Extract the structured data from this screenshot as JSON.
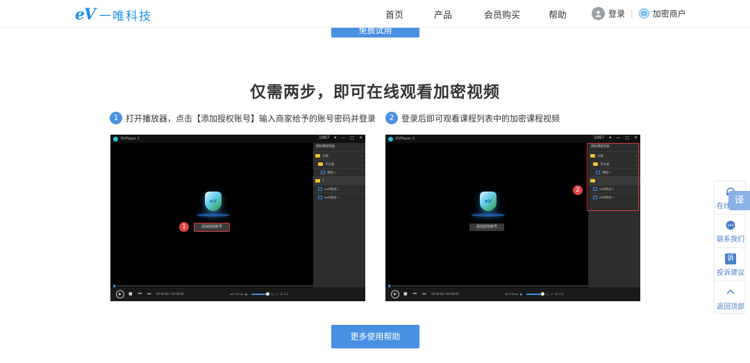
{
  "header": {
    "logo_mark": "eV",
    "logo_text": "一唯科技",
    "nav": [
      "首页",
      "产品",
      "会员购买",
      "帮助"
    ],
    "login": "登录",
    "separator": "|",
    "merchant": "加密商户"
  },
  "top_button": "免费试用",
  "section": {
    "title": "仅需两步，即可在线观看加密视频",
    "steps": [
      {
        "num": "1",
        "text": "打开播放器，点击【添加授权账号】输入商家给予的账号密码并登录"
      },
      {
        "num": "2",
        "text": "登录后即可观看课程列表中的加密课程视频"
      }
    ]
  },
  "players": [
    {
      "title": "EVPlayer 2",
      "user": "1997",
      "add_button": "添加授权账号",
      "playlist_header": "授权课程列表",
      "rows": [
        {
          "type": "folder",
          "label": "分类"
        },
        {
          "type": "folder",
          "label": "子分类"
        },
        {
          "type": "file",
          "label": "课程一"
        },
        {
          "type": "folder",
          "label": "1"
        },
        {
          "type": "file",
          "label": "ev6格式二"
        },
        {
          "type": "file",
          "label": "ev6格式一"
        }
      ],
      "time": "00:00:00 / 00:00:00",
      "speed": "1.0x",
      "version": "v2.1.2",
      "marker": "1"
    },
    {
      "title": "EVPlayer 2",
      "user": "1997",
      "add_button": "添加授权账号",
      "playlist_header": "授权课程列表",
      "rows": [
        {
          "type": "folder",
          "label": "分类"
        },
        {
          "type": "folder",
          "label": "子分类"
        },
        {
          "type": "file",
          "label": "课程一"
        },
        {
          "type": "folder",
          "label": ""
        },
        {
          "type": "file",
          "label": "ev6格式二"
        },
        {
          "type": "file",
          "label": "ev6格式一"
        }
      ],
      "time": "00:00:00 / 00:00:00",
      "speed": "1.0x",
      "version": "v2.1.2",
      "marker": "2"
    }
  ],
  "help_button": "更多使用帮助",
  "float_panel": {
    "items": [
      "在线客服",
      "联系我们",
      "投诉建议",
      "返回顶部"
    ],
    "complaint_glyph": "诉",
    "translate": "译"
  }
}
